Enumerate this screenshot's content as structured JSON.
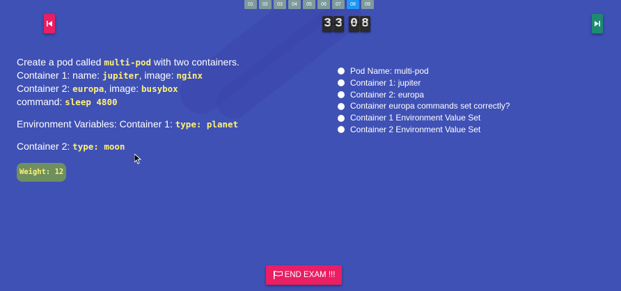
{
  "question_nav": {
    "items": [
      "01",
      "02",
      "03",
      "04",
      "05",
      "06",
      "07",
      "08",
      "09"
    ],
    "active": "08"
  },
  "timer": {
    "minutes": [
      "3",
      "3"
    ],
    "seconds": [
      "0",
      "8"
    ]
  },
  "question": {
    "line1_pre": "Create a pod called ",
    "line1_code": "multi-pod",
    "line1_post": " with two containers.",
    "c1_pre": "Container 1: name: ",
    "c1_name": "jupiter",
    "c1_mid": ", image: ",
    "c1_image": "nginx",
    "c2_pre": "Container 2: ",
    "c2_name": "europa",
    "c2_mid": ", image: ",
    "c2_image": "busybox",
    "cmd_pre": "command: ",
    "cmd_code": "sleep 4800",
    "env_pre": "Environment Variables: Container 1: ",
    "env_code1": "type: planet",
    "env2_pre": "Container 2: ",
    "env_code2": "type: moon",
    "weight": "Weight: 12"
  },
  "checks": [
    "Pod Name: multi-pod",
    "Container 1: jupiter",
    "Container 2: europa",
    "Container europa commands set correctly?",
    "Container 1 Environment Value Set",
    "Container 2 Environment Value Set"
  ],
  "end_exam": {
    "label": "END EXAM !!!"
  },
  "icons": {
    "prev": "skip-previous-icon",
    "next": "skip-next-icon",
    "flag": "flag-icon"
  },
  "colors": {
    "background": "#3f51b5",
    "code": "#fff176",
    "active_question": "#2196f3",
    "question_button": "#7f9a9c",
    "prev_button": "#e91e63",
    "next_button": "#1e8a72",
    "end_button": "#e91e63",
    "weight_badge": "#6e8f5f"
  }
}
